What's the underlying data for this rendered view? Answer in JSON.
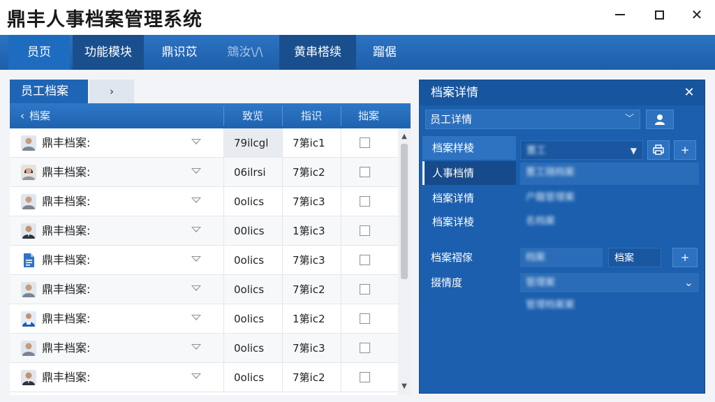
{
  "window": {
    "title": "鼎丰人事档案管理系统",
    "close_glyph": "✕"
  },
  "menu": {
    "items": [
      {
        "label": "员页"
      },
      {
        "label": "功能模块"
      },
      {
        "label": "鼎识苡"
      },
      {
        "label": "鵍汝\\/\\"
      },
      {
        "label": "黄串榙续"
      },
      {
        "label": "蹓倨"
      }
    ]
  },
  "left_panel": {
    "tab_active": "员工档案",
    "tab_next": "›",
    "header": {
      "back": "‹",
      "name": "档案",
      "col1": "致览",
      "col2": "指识",
      "col3": "拙案"
    },
    "rows": [
      {
        "name": "鼎丰档案:",
        "c1": "79ilcgl",
        "c2": "7第ic1",
        "avatar": "person-male-icon"
      },
      {
        "name": "鼎丰档案:",
        "c1": "06ilrsi",
        "c2": "7第ic2",
        "avatar": "person-female-icon"
      },
      {
        "name": "鼎丰档案:",
        "c1": "0olics",
        "c2": "7第ic3",
        "avatar": "person-male-icon"
      },
      {
        "name": "鼎丰档案:",
        "c1": "00lics",
        "c2": "1第ic3",
        "avatar": "person-suit-icon"
      },
      {
        "name": "鼎丰档案:",
        "c1": "0olics",
        "c2": "7第ic3",
        "avatar": "document-icon"
      },
      {
        "name": "鼎丰档案:",
        "c1": "0olics",
        "c2": "7第ic2",
        "avatar": "person-male-icon"
      },
      {
        "name": "鼎丰档案:",
        "c1": "0olics",
        "c2": "1第ic2",
        "avatar": "person-badge-icon"
      },
      {
        "name": "鼎丰档案:",
        "c1": "0olics",
        "c2": "7第ic3",
        "avatar": "person-male-icon"
      },
      {
        "name": "鼎丰档案:",
        "c1": "0olics",
        "c2": "7第ic2",
        "avatar": "person-suit-icon"
      }
    ]
  },
  "right_panel": {
    "title": "档案详情",
    "select_value": "员工详情",
    "nav": [
      {
        "label": "档案样棱"
      },
      {
        "label": "人事档情"
      },
      {
        "label": "档案详情"
      },
      {
        "label": "档案详棱"
      }
    ],
    "field1_value": "置工",
    "blurred_line1": "置工随档案",
    "blurred_line2": "户籍管理案",
    "blurred_line3": "名档案",
    "label_a": "档案褶傢",
    "field_a1": "档案",
    "field_a2": "档案",
    "label_b": "掇情度",
    "field_b": "管理案",
    "blurred_line4": "管理档案案",
    "plus": "+",
    "chevron": "⌄"
  },
  "colors": {
    "menu_bg": "#1d5ea8",
    "panel_bg": "#1b5fae",
    "active_tab": "#1f65b5"
  }
}
